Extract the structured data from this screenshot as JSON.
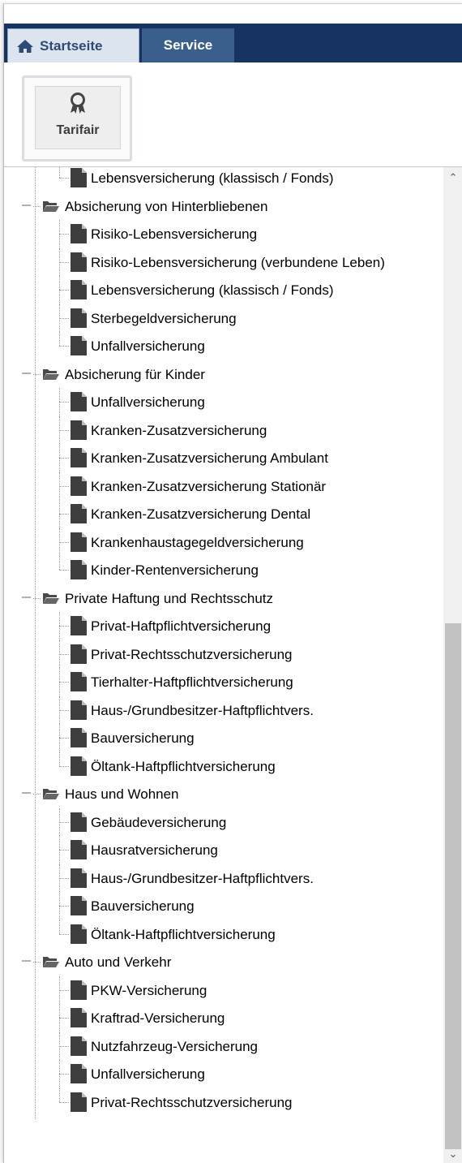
{
  "tabs": {
    "home": "Startseite",
    "service": "Service"
  },
  "ribbon": {
    "tarifair_label": "Tarifair"
  },
  "tree": [
    {
      "type": "leaf",
      "label": "Lebensversicherung (klassisch / Fonds)"
    },
    {
      "type": "folder",
      "label": "Absicherung von Hinterbliebenen"
    },
    {
      "type": "leaf",
      "label": "Risiko-Lebensversicherung"
    },
    {
      "type": "leaf",
      "label": "Risiko-Lebensversicherung (verbundene Leben)"
    },
    {
      "type": "leaf",
      "label": "Lebensversicherung (klassisch / Fonds)"
    },
    {
      "type": "leaf",
      "label": "Sterbegeldversicherung"
    },
    {
      "type": "leaf",
      "label": "Unfallversicherung"
    },
    {
      "type": "folder",
      "label": "Absicherung für Kinder"
    },
    {
      "type": "leaf",
      "label": "Unfallversicherung"
    },
    {
      "type": "leaf",
      "label": "Kranken-Zusatzversicherung"
    },
    {
      "type": "leaf",
      "label": "Kranken-Zusatzversicherung Ambulant"
    },
    {
      "type": "leaf",
      "label": "Kranken-Zusatzversicherung Stationär"
    },
    {
      "type": "leaf",
      "label": "Kranken-Zusatzversicherung Dental"
    },
    {
      "type": "leaf",
      "label": "Krankenhaustagegeldversicherung"
    },
    {
      "type": "leaf",
      "label": "Kinder-Rentenversicherung"
    },
    {
      "type": "folder",
      "label": "Private Haftung und Rechtsschutz"
    },
    {
      "type": "leaf",
      "label": "Privat-Haftpflichtversicherung"
    },
    {
      "type": "leaf",
      "label": "Privat-Rechtsschutzversicherung"
    },
    {
      "type": "leaf",
      "label": "Tierhalter-Haftpflichtversicherung"
    },
    {
      "type": "leaf",
      "label": "Haus-/Grundbesitzer-Haftpflichtvers."
    },
    {
      "type": "leaf",
      "label": "Bauversicherung"
    },
    {
      "type": "leaf",
      "label": "Öltank-Haftpflichtversicherung"
    },
    {
      "type": "folder",
      "label": "Haus und Wohnen"
    },
    {
      "type": "leaf",
      "label": "Gebäudeversicherung"
    },
    {
      "type": "leaf",
      "label": "Hausratversicherung"
    },
    {
      "type": "leaf",
      "label": "Haus-/Grundbesitzer-Haftpflichtvers."
    },
    {
      "type": "leaf",
      "label": "Bauversicherung"
    },
    {
      "type": "leaf",
      "label": "Öltank-Haftpflichtversicherung"
    },
    {
      "type": "folder",
      "label": "Auto und Verkehr"
    },
    {
      "type": "leaf",
      "label": "PKW-Versicherung"
    },
    {
      "type": "leaf",
      "label": "Kraftrad-Versicherung"
    },
    {
      "type": "leaf",
      "label": "Nutzfahrzeug-Versicherung"
    },
    {
      "type": "leaf",
      "label": "Unfallversicherung"
    },
    {
      "type": "leaf",
      "label": "Privat-Rechtsschutzversicherung"
    }
  ],
  "icons": {
    "home": "home-icon",
    "tarifair": "award-ribbon-icon",
    "folder": "folder-open-icon",
    "file": "file-icon"
  },
  "colors": {
    "ribbon": "#17335f",
    "active_tab": "#dce5ef",
    "service_tab": "#3b5f8c"
  }
}
